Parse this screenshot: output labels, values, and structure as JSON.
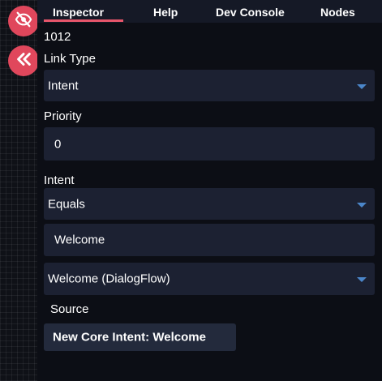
{
  "tabs": [
    {
      "label": "Inspector",
      "active": true
    },
    {
      "label": "Help"
    },
    {
      "label": "Dev Console"
    },
    {
      "label": "Nodes"
    }
  ],
  "node_id": "1012",
  "link_type": {
    "label": "Link Type",
    "value": "Intent"
  },
  "priority": {
    "label": "Priority",
    "value": "0"
  },
  "intent": {
    "label": "Intent",
    "operator": "Equals",
    "value": "Welcome",
    "source_select": "Welcome (DialogFlow)"
  },
  "source": {
    "label": "Source",
    "button_label": "New Core Intent: Welcome"
  },
  "floating_buttons": {
    "hide": {
      "icon": "eye-off-icon"
    },
    "collapse": {
      "icon": "double-chevron-left-icon"
    }
  },
  "colors": {
    "accent": "#e0475c",
    "caret": "#4b86c9",
    "field_bg": "#1c2132",
    "panel_bg": "#0c0e15",
    "tabbar_bg": "#151926"
  }
}
